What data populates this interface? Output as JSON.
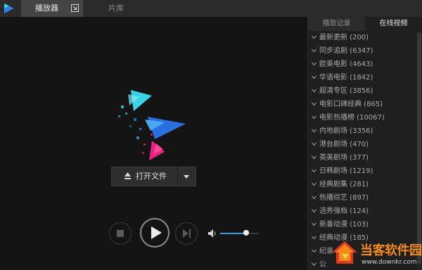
{
  "colors": {
    "accent": "#2ea0e8",
    "brand_cyan": "#39d3e6",
    "brand_blue": "#2a6fe0",
    "brand_pink": "#e8237e",
    "watermark_orange": "#f28a1b"
  },
  "header": {
    "tabs": [
      {
        "label": "播放器",
        "active": true
      },
      {
        "label": "片库",
        "active": false
      }
    ]
  },
  "player": {
    "open_file_label": "打开文件",
    "volume_level": 0.68
  },
  "sidebar": {
    "tabs": [
      {
        "label": "播放记录",
        "active": false
      },
      {
        "label": "在线视频",
        "active": true
      }
    ],
    "categories": [
      {
        "label": "最新更新 (200)"
      },
      {
        "label": "同步追剧 (6347)"
      },
      {
        "label": "欧美电影 (4643)"
      },
      {
        "label": "华语电影 (1842)"
      },
      {
        "label": "超清专区 (3856)"
      },
      {
        "label": "电影口碑经典 (865)"
      },
      {
        "label": "电影热播榜 (10067)"
      },
      {
        "label": "内地剧场 (3356)"
      },
      {
        "label": "港台剧场 (470)"
      },
      {
        "label": "英美剧场 (377)"
      },
      {
        "label": "日韩剧场 (1219)"
      },
      {
        "label": "经典剧集 (281)"
      },
      {
        "label": "热播综艺 (897)"
      },
      {
        "label": "选秀强档 (124)"
      },
      {
        "label": "新番动漫 (103)"
      },
      {
        "label": "经典动漫 (185)"
      },
      {
        "label": "纪录"
      },
      {
        "label": "公"
      }
    ]
  },
  "watermark": {
    "title": "当客软件园",
    "url": "www.downkr.com"
  }
}
